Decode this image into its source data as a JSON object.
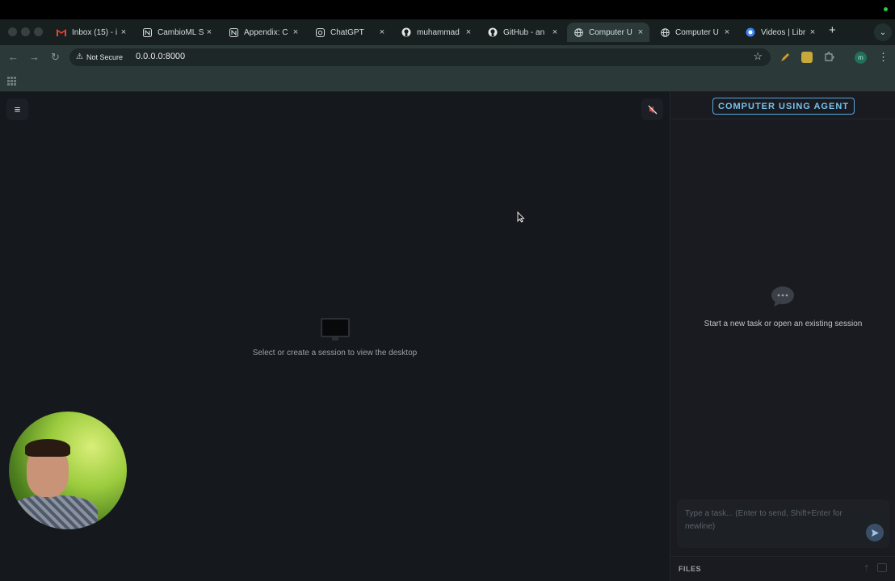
{
  "browser": {
    "tabs": [
      {
        "icon": "gmail-icon",
        "title": "Inbox (15) - i",
        "active": false
      },
      {
        "icon": "notion-icon",
        "title": "CambioML S",
        "active": false
      },
      {
        "icon": "notion-icon",
        "title": "Appendix: C",
        "active": false
      },
      {
        "icon": "chatgpt-icon",
        "title": "ChatGPT",
        "active": false
      },
      {
        "icon": "github-icon",
        "title": "muhammad",
        "active": false
      },
      {
        "icon": "github-icon",
        "title": "GitHub - an",
        "active": false
      },
      {
        "icon": "globe-icon",
        "title": "Computer U",
        "active": true
      },
      {
        "icon": "globe-icon",
        "title": "Computer U",
        "active": false
      },
      {
        "icon": "library-icon",
        "title": "Videos | Libr",
        "active": false
      }
    ],
    "close_glyph": "×",
    "new_tab_glyph": "+",
    "security_label": "Not Secure",
    "url": "0.0.0.0:8000"
  },
  "app": {
    "empty_desktop_text": "Select or create a session to view the desktop",
    "agent_title": "COMPUTER USING AGENT",
    "empty_chat_text": "Start a new task or open an existing session",
    "input_placeholder": "Type a task... (Enter to send, Shift+Enter for newline)",
    "files_label": "FILES"
  },
  "colors": {
    "accent": "#5aa7dc",
    "browser_chrome": "#2b3a39",
    "app_bg": "#15181d"
  }
}
